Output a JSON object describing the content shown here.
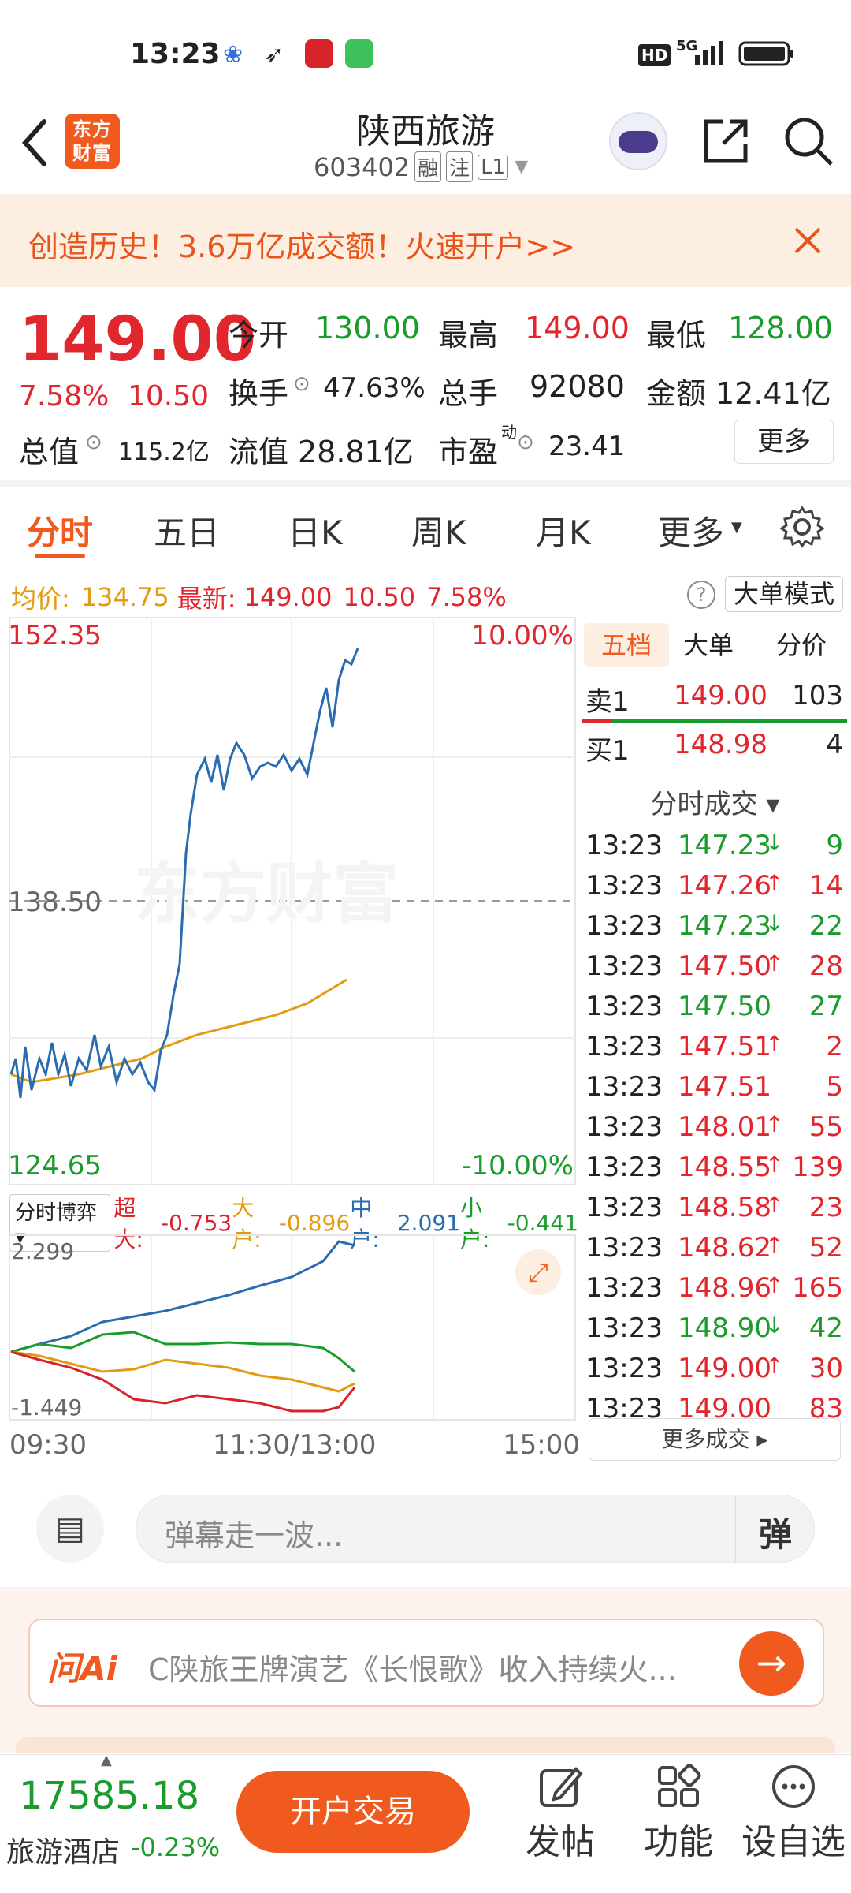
{
  "status_bar": {
    "time": "13:23",
    "network": "5G",
    "hd": "HD"
  },
  "header": {
    "logo_text": "东方财富",
    "stock_name": "陕西旅游",
    "stock_code": "603402",
    "tags": [
      "融",
      "注",
      "L1"
    ]
  },
  "banner": {
    "text": "创造历史！3.6万亿成交额！火速开户>>"
  },
  "quote": {
    "price": "149.00",
    "change_pct": "7.58%",
    "change": "10.50",
    "open_label": "今开",
    "open": "130.00",
    "high_label": "最高",
    "high": "149.00",
    "low_label": "最低",
    "low": "128.00",
    "turnover_label": "换手",
    "turnover": "47.63%",
    "volume_label": "总手",
    "volume": "92080",
    "amount_label": "金额",
    "amount": "12.41亿",
    "mktcap_label": "总值",
    "mktcap": "115.2亿",
    "float_label": "流值",
    "float": "28.81亿",
    "pe_label": "市盈",
    "pe_sup": "动",
    "pe": "23.41",
    "more": "更多"
  },
  "tabs": {
    "items": [
      "分时",
      "五日",
      "日K",
      "周K",
      "月K",
      "更多"
    ],
    "active": 0
  },
  "info_line": {
    "avg_label": "均价:",
    "avg": "134.75",
    "latest_label": "最新:",
    "latest": "149.00",
    "change": "10.50",
    "pct": "7.58%",
    "mode_btn": "大单模式"
  },
  "chart": {
    "top_price": "152.35",
    "top_pct": "10.00%",
    "mid_price": "138.50",
    "bottom_price": "124.65",
    "bottom_pct": "-10.00%",
    "watermark": "东方财富",
    "time_start": "09:30",
    "time_mid": "11:30/13:00",
    "time_end": "15:00",
    "flow_selector": "分时博弈",
    "flow_items": [
      {
        "label": "超大:",
        "value": "-0.753",
        "color": "#d9232b"
      },
      {
        "label": "大户:",
        "value": "-0.896",
        "color": "#e39b12"
      },
      {
        "label": "中户:",
        "value": "2.091",
        "color": "#2b6cb0"
      },
      {
        "label": "小户:",
        "value": "-0.441",
        "color": "#1a9c2c"
      }
    ],
    "flow_max": "2.299",
    "flow_min": "-1.449"
  },
  "chart_data": {
    "type": "line",
    "y_range": [
      124.65,
      152.35
    ],
    "reference": 138.5,
    "series": []
  },
  "orderbook": {
    "tabs": [
      "五档",
      "大单",
      "分价"
    ],
    "sell1_label": "卖1",
    "sell1_price": "149.00",
    "sell1_vol": "103",
    "buy1_label": "买1",
    "buy1_price": "148.98",
    "buy1_vol": "4",
    "trades_title": "分时成交",
    "trades": [
      {
        "t": "13:23",
        "p": "147.23",
        "d": "↓",
        "v": "9",
        "c": "g"
      },
      {
        "t": "13:23",
        "p": "147.26",
        "d": "↑",
        "v": "14",
        "c": "r"
      },
      {
        "t": "13:23",
        "p": "147.23",
        "d": "↓",
        "v": "22",
        "c": "g"
      },
      {
        "t": "13:23",
        "p": "147.50",
        "d": "↑",
        "v": "28",
        "c": "r"
      },
      {
        "t": "13:23",
        "p": "147.50",
        "d": "",
        "v": "27",
        "c": "g"
      },
      {
        "t": "13:23",
        "p": "147.51",
        "d": "↑",
        "v": "2",
        "c": "r"
      },
      {
        "t": "13:23",
        "p": "147.51",
        "d": "",
        "v": "5",
        "c": "r"
      },
      {
        "t": "13:23",
        "p": "148.01",
        "d": "↑",
        "v": "55",
        "c": "r"
      },
      {
        "t": "13:23",
        "p": "148.55",
        "d": "↑",
        "v": "139",
        "c": "r"
      },
      {
        "t": "13:23",
        "p": "148.58",
        "d": "↑",
        "v": "23",
        "c": "r"
      },
      {
        "t": "13:23",
        "p": "148.62",
        "d": "↑",
        "v": "52",
        "c": "r"
      },
      {
        "t": "13:23",
        "p": "148.96",
        "d": "↑",
        "v": "165",
        "c": "r"
      },
      {
        "t": "13:23",
        "p": "148.90",
        "d": "↓",
        "v": "42",
        "c": "g"
      },
      {
        "t": "13:23",
        "p": "149.00",
        "d": "↑",
        "v": "30",
        "c": "r"
      },
      {
        "t": "13:23",
        "p": "149.00",
        "d": "",
        "v": "83",
        "c": "r"
      }
    ],
    "more_trades": "更多成交"
  },
  "comment": {
    "placeholder": "弹幕走一波...",
    "danmu_btn": "弹"
  },
  "ai": {
    "brand": "问Ai",
    "text": "C陕旅王牌演艺《长恨歌》收入持续火..."
  },
  "bottom": {
    "index_value": "17585.18",
    "index_name": "旅游酒店",
    "index_change": "-0.23%",
    "trade_btn": "开户交易",
    "post": "发帖",
    "func": "功能",
    "watch": "设自选"
  }
}
